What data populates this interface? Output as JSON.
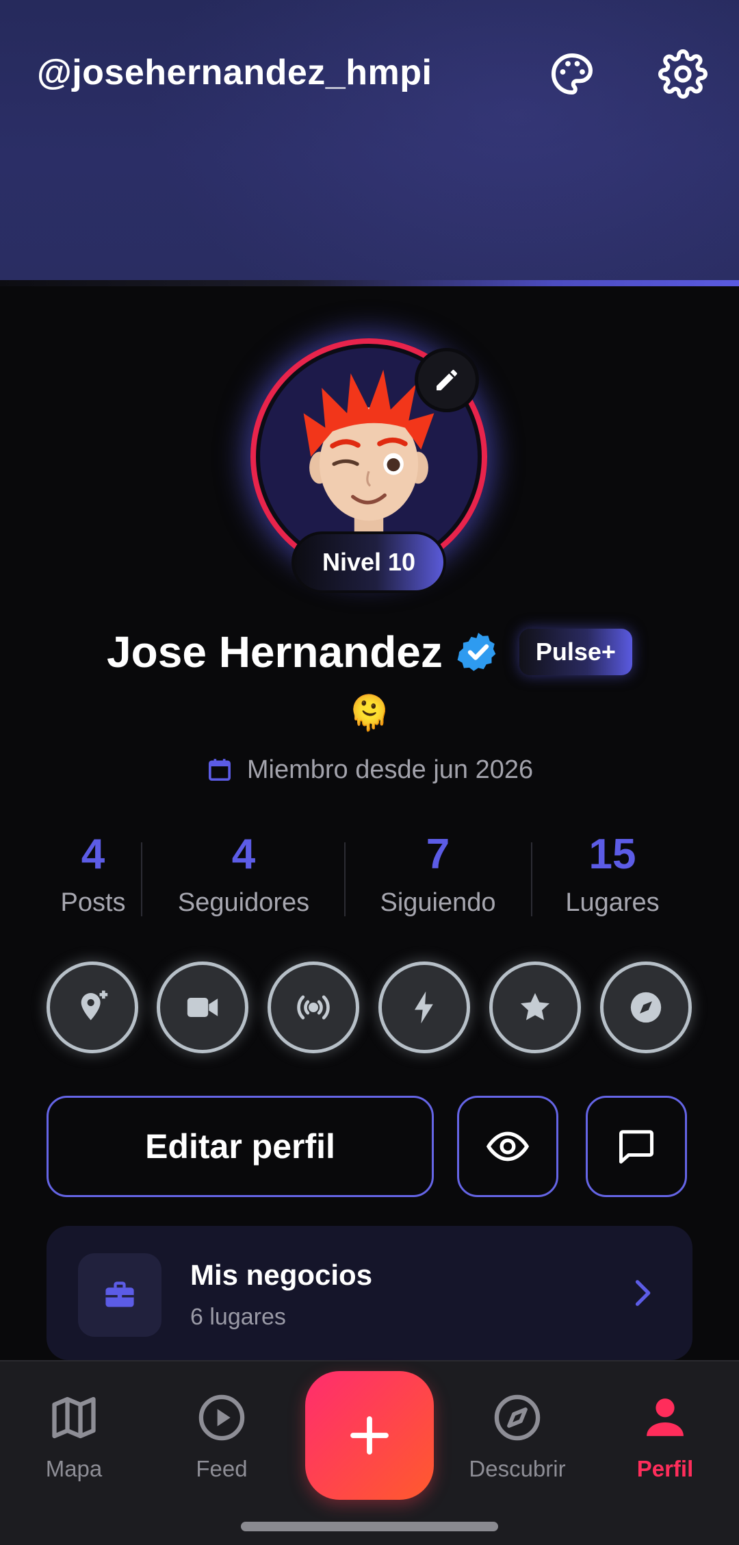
{
  "header": {
    "handle": "@josehernandez_hmpi",
    "icons": [
      "palette-icon",
      "gear-icon"
    ],
    "accent_color": "#5a5ae0"
  },
  "profile": {
    "level_label": "Nivel 10",
    "name": "Jose Hernandez",
    "verified": true,
    "badge": "Pulse+",
    "emoji": "🫠",
    "member_since": "Miembro desde jun 2026",
    "ring_color": "#e8244c"
  },
  "stats": [
    {
      "value": "4",
      "label": "Posts"
    },
    {
      "value": "4",
      "label": "Seguidores"
    },
    {
      "value": "7",
      "label": "Siguiendo"
    },
    {
      "value": "15",
      "label": "Lugares"
    }
  ],
  "achievements": [
    "add-location-icon",
    "video-camera-icon",
    "broadcast-icon",
    "lightning-icon",
    "star-icon",
    "compass-icon"
  ],
  "actions": {
    "edit_profile": "Editar perfil",
    "icons": [
      "eye-icon",
      "chat-icon"
    ]
  },
  "business": {
    "title": "Mis negocios",
    "subtitle": "6 lugares"
  },
  "nav": {
    "items": [
      {
        "label": "Mapa",
        "icon": "map-icon"
      },
      {
        "label": "Feed",
        "icon": "play-circle-icon"
      },
      {
        "label": "Descubrir",
        "icon": "compass-icon"
      },
      {
        "label": "Perfil",
        "icon": "person-icon"
      }
    ],
    "active": "Perfil",
    "active_color": "#ff2d5b"
  }
}
